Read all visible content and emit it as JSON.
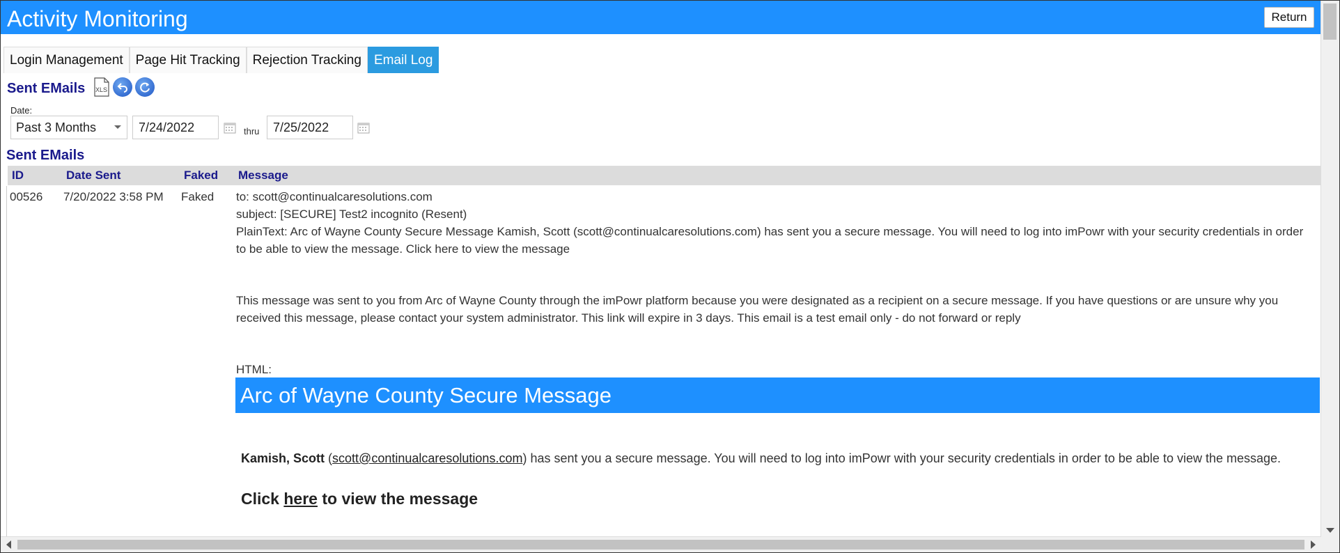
{
  "header": {
    "title": "Activity Monitoring",
    "return_label": "Return"
  },
  "tabs": [
    {
      "label": "Login Management",
      "active": false
    },
    {
      "label": "Page Hit Tracking",
      "active": false
    },
    {
      "label": "Rejection Tracking",
      "active": false
    },
    {
      "label": "Email Log",
      "active": true
    }
  ],
  "toolbar": {
    "section_title": "Sent EMails",
    "icons": [
      "xls-export-icon",
      "back-icon",
      "refresh-icon"
    ],
    "xls_text": "XLS"
  },
  "filter": {
    "date_label": "Date:",
    "range_selected": "Past 3 Months",
    "start_date": "7/24/2022",
    "thru_label": "thru",
    "end_date": "7/25/2022"
  },
  "grid": {
    "title": "Sent EMails",
    "columns": [
      "ID",
      "Date Sent",
      "Faked",
      "Message"
    ],
    "rows": [
      {
        "id": "00526",
        "date_sent": "7/20/2022 3:58 PM",
        "faked": "Faked",
        "to": "to: scott@continualcaresolutions.com",
        "subject": "subject: [SECURE] Test2 incognito (Resent)",
        "plaintext": "PlainText: Arc of Wayne County Secure Message Kamish, Scott (scott@continualcaresolutions.com) has sent you a secure message. You will need to log into imPowr with your security credentials in order to be able to view the message. Click here to view the message",
        "notice": "This message was sent to you from Arc of Wayne County through the imPowr platform because you were designated as a recipient on a secure message. If you have questions or are unsure why you received this message, please contact your system administrator. This link will expire in 3 days. This email is a test email only - do not forward or reply",
        "html_label": "HTML:",
        "html_banner": "Arc of Wayne County Secure Message",
        "sender_name": "Kamish, Scott",
        "sender_email": "scott@continualcaresolutions.com",
        "open_paren": "(",
        "body_rest": ") has sent you a secure message. You will need to log into imPowr with your security credentials in order to be able to view the message.",
        "click_prefix": "Click ",
        "click_link": "here",
        "click_suffix": " to view the message"
      }
    ]
  },
  "colors": {
    "accent": "#1e90ff",
    "tab_active": "#2b9be0",
    "heading": "#1a1a8c",
    "grid_header_bg": "#dcdcdc"
  }
}
